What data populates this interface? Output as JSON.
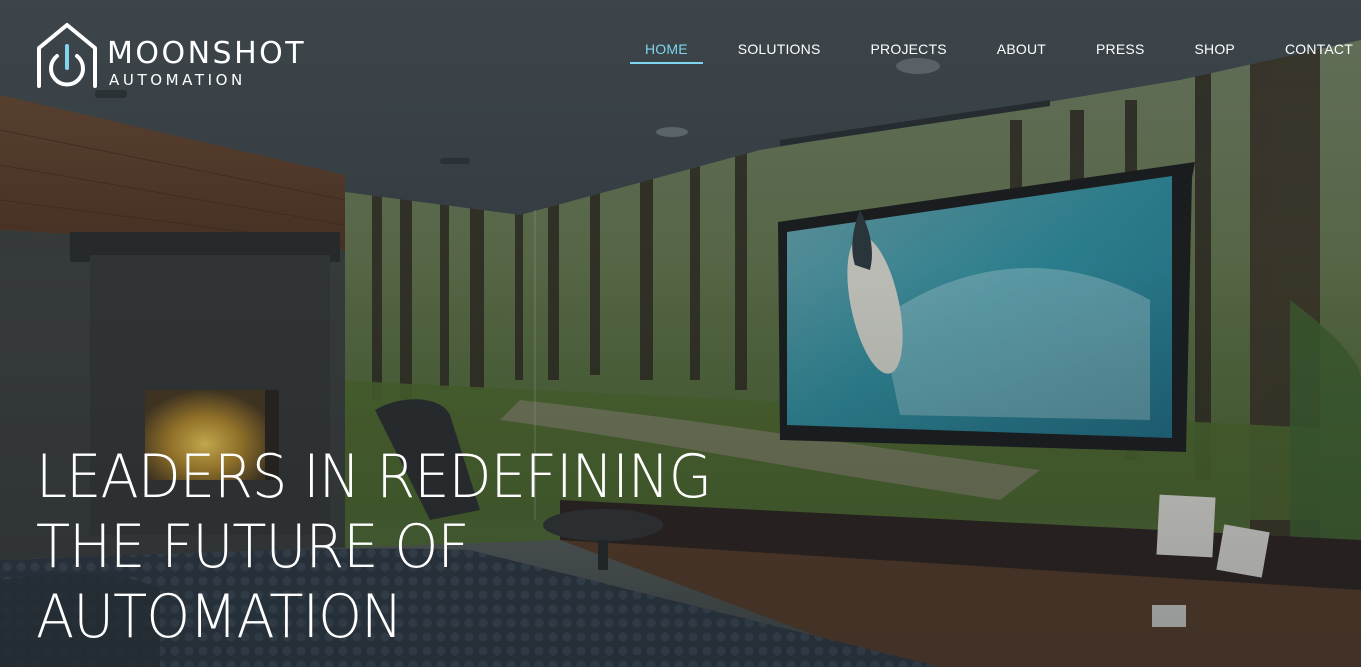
{
  "brand": {
    "name": "MOONSHOT",
    "tagline": "AUTOMATION",
    "icon": "house-power-icon"
  },
  "nav": {
    "items": [
      {
        "label": "HOME",
        "active": true
      },
      {
        "label": "SOLUTIONS",
        "active": false
      },
      {
        "label": "PROJECTS",
        "active": false
      },
      {
        "label": "ABOUT",
        "active": false
      },
      {
        "label": "PRESS",
        "active": false
      },
      {
        "label": "SHOP",
        "active": false
      },
      {
        "label": "CONTACT",
        "active": false
      }
    ]
  },
  "hero": {
    "headline_lines": [
      "LEADERS IN REDEFINING",
      "THE FUTURE OF",
      "AUTOMATION"
    ]
  },
  "colors": {
    "accent": "#7fd4ee",
    "text": "#ffffff"
  }
}
